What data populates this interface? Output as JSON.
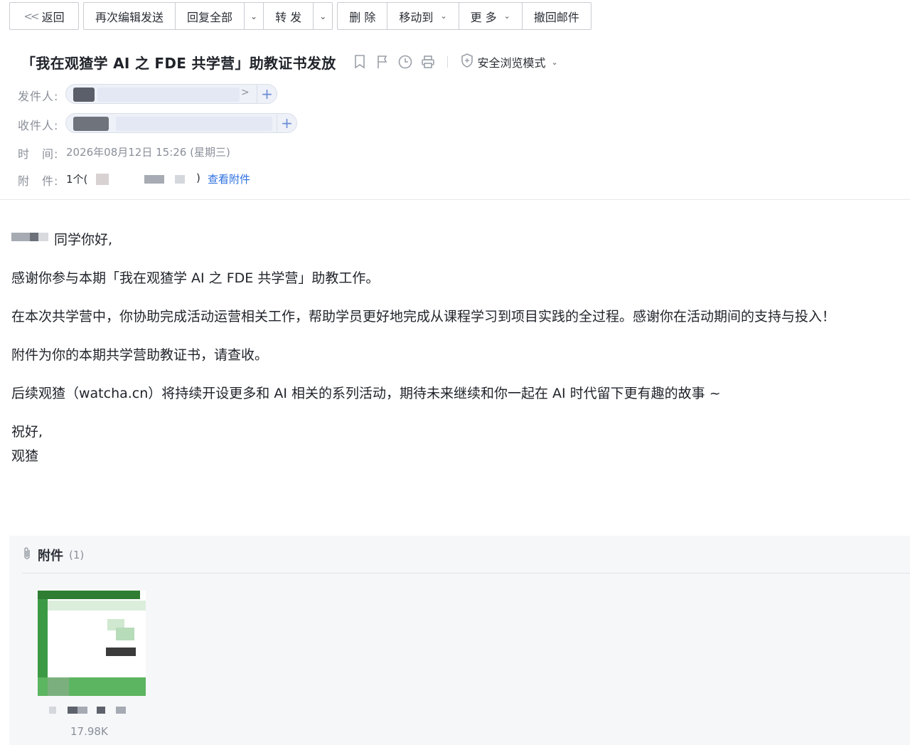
{
  "toolbar": {
    "back": "返回",
    "reedit": "再次编辑发送",
    "reply_all": "回复全部",
    "forward": "转 发",
    "delete": "删 除",
    "move_to": "移动到",
    "more": "更 多",
    "recall": "撤回邮件"
  },
  "subject": "「我在观猹学 AI 之 FDE 共学营」助教证书发放",
  "safe_mode": "安全浏览模式",
  "meta": {
    "from_label": "发件人:",
    "to_label": "收件人:",
    "time_label": "时　间:",
    "time_value": "2026年08月12日 15:26 (星期三)",
    "attach_label": "附　件:",
    "attach_count_prefix": "1个(",
    "attach_count_suffix": ")",
    "view_attachments": "查看附件"
  },
  "body": {
    "greeting": "同学你好,",
    "p1": "感谢你参与本期「我在观猹学 AI 之 FDE 共学营」助教工作。",
    "p2": "在本次共学营中，你协助完成活动运营相关工作，帮助学员更好地完成从课程学习到项目实践的全过程。感谢你在活动期间的支持与投入！",
    "p3": "附件为你的本期共学营助教证书，请查收。",
    "p4": "后续观猹（watcha.cn）将持续开设更多和 AI 相关的系列活动，期待未来继续和你一起在 AI 时代留下更有趣的故事 ~",
    "closing": "祝好,",
    "signature": "观猹"
  },
  "attachments": {
    "title": "附件",
    "count": "(1)",
    "items": [
      {
        "size": "17.98K"
      }
    ]
  },
  "icons": {
    "bookmark": "bookmark-icon",
    "flag": "flag-icon",
    "clock": "clock-icon",
    "print": "print-icon",
    "shield": "shield-icon",
    "paperclip": "paperclip-icon"
  },
  "colors": {
    "link": "#2d6fe0",
    "label": "#8a8f99",
    "chip_bg": "#eef1f8",
    "thumb_green": "#3c9a44"
  }
}
